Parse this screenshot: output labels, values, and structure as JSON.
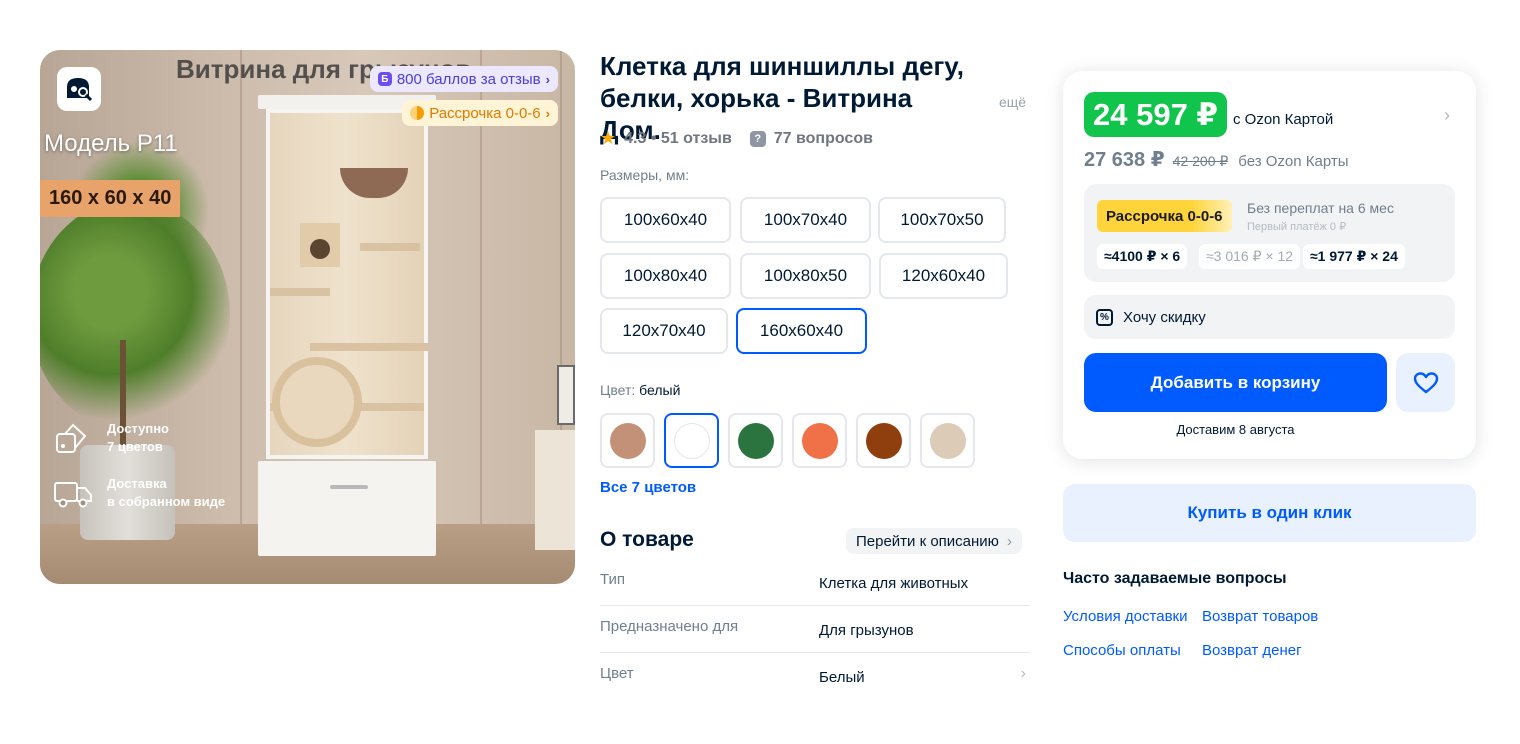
{
  "gallery": {
    "overlay_title": "Витрина для грызунов",
    "model": "Модель Р11",
    "dimensions_badge": "160 x 60 x 40",
    "points_badge": "800 баллов за отзыв",
    "points_icon_letter": "Б",
    "installment_badge": "Рассрочка 0-0-6",
    "feature_colors": [
      "Доступно",
      "7 цветов"
    ],
    "feature_delivery": [
      "Доставка",
      "в собранном виде"
    ]
  },
  "product": {
    "title": "Клетка для шиншиллы дегу, белки, хорька - Витрина Дом.",
    "more": "ещё",
    "rating": "4.3 • 51 отзыв",
    "questions": "77 вопросов",
    "sizes_label": "Размеры, мм:",
    "sizes": [
      "100x60x40",
      "100x70x40",
      "100x70x50",
      "100x80x40",
      "100x80x50",
      "120x60x40",
      "120x70x40",
      "160x60x40"
    ],
    "selected_size": "160x60x40",
    "color_label": "Цвет:",
    "color_value": "белый",
    "swatches": [
      "#c29177",
      "#ffffff",
      "#2b7440",
      "#f07048",
      "#8f3f0d",
      "#dccbb7"
    ],
    "all_colors": "Все 7 цветов"
  },
  "about": {
    "title": "О товаре",
    "link": "Перейти к описанию",
    "specs": [
      {
        "key": "Тип",
        "value": "Клетка для животных"
      },
      {
        "key": "Предназначено для",
        "value": "Для грызунов"
      },
      {
        "key": "Цвет",
        "value": "Белый"
      }
    ]
  },
  "price": {
    "card_price": "24 597 ₽",
    "card_note": "с Ozon Картой",
    "price_no_card": "27 638 ₽",
    "old_price": "42 200 ₽",
    "no_card_note": "без Ozon Карты",
    "installment_badge": "Рассрочка 0-0-6",
    "installment_desc": "Без переплат на 6 мес",
    "installment_first": "Первый платёж 0 ₽",
    "chips": [
      "≈4100 ₽ × 6",
      "≈3 016 ₽ × 12",
      "≈1 977 ₽ × 24"
    ],
    "discount": "Хочу скидку",
    "cart": "Добавить в корзину",
    "delivery": "Доставим 8 августа",
    "one_click": "Купить в один клик"
  },
  "faq": {
    "title": "Часто задаваемые вопросы",
    "links": [
      "Условия доставки",
      "Возврат товаров",
      "Способы оплаты",
      "Возврат денег"
    ]
  },
  "colors": {
    "accent": "#005bff",
    "price_green": "#10c44c",
    "installment_yellow": "#ffd43b"
  }
}
